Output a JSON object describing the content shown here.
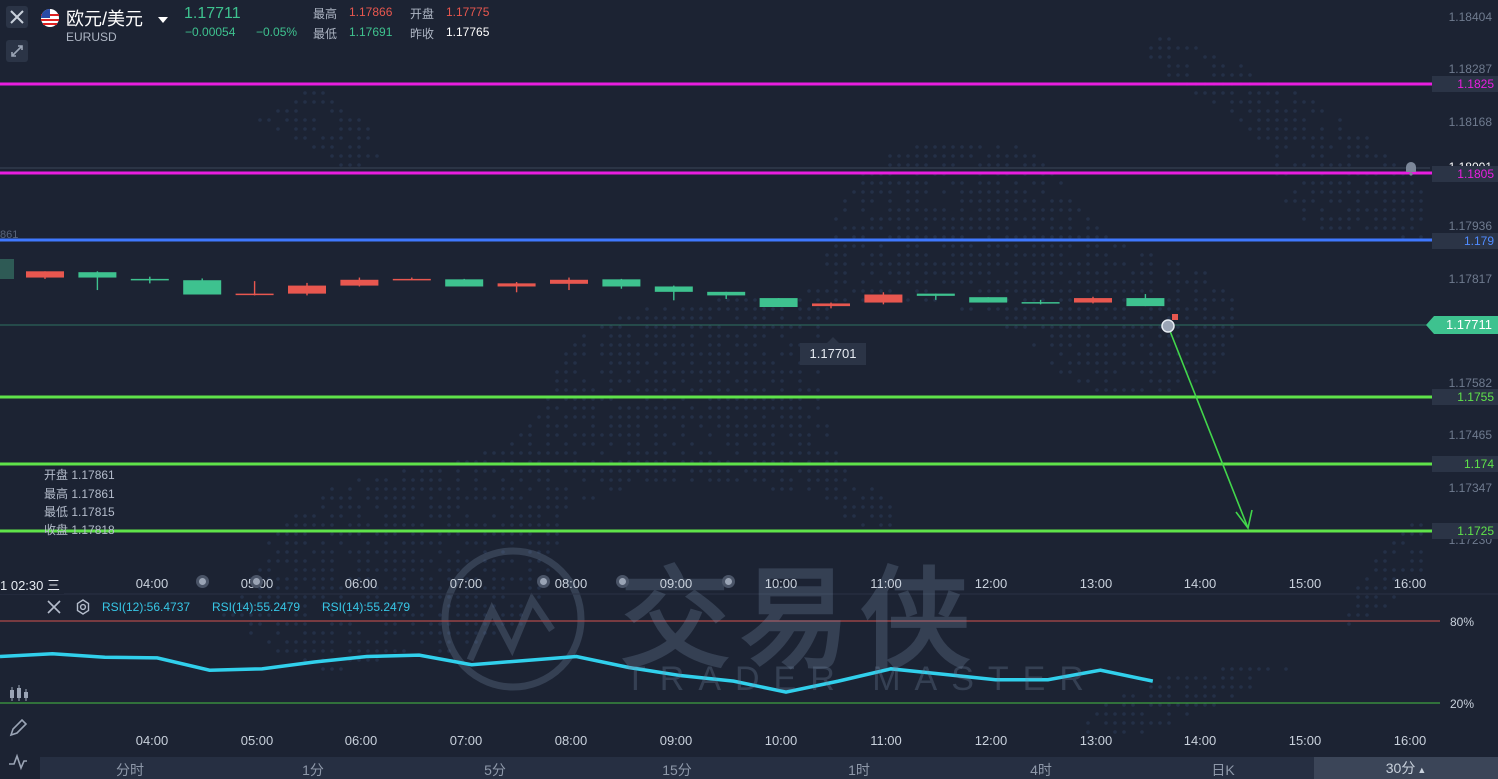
{
  "header": {
    "title": "欧元/美元",
    "symbol": "EURUSD",
    "price": "1.17711",
    "change": "−0.00054",
    "change_pct": "−0.05%",
    "high_label": "最高",
    "high_value": "1.17866",
    "open_label": "开盘",
    "open_value": "1.17775",
    "low_label": "最低",
    "low_value": "1.17691",
    "prev_close_label": "昨收",
    "prev_close_value": "1.17765"
  },
  "price_axis": [
    "1.18404",
    "1.18287",
    "1.18168",
    "1.17936",
    "1.17817",
    "1.17582",
    "1.17465",
    "1.17347",
    "1.17230"
  ],
  "price_axis_overlap": "1.18001",
  "lines": [
    {
      "label": "1.1825",
      "color": "#e91ee0"
    },
    {
      "label": "1.1805",
      "color": "#e91ee0"
    },
    {
      "label": "1.179",
      "color": "#3f78ff"
    },
    {
      "label": "1.1755",
      "color": "#5fe34a"
    },
    {
      "label": "1.174",
      "color": "#5fe34a"
    },
    {
      "label": "1.1725",
      "color": "#5fe34a"
    }
  ],
  "current_price_tag": "1.17711",
  "crosshair_value": "1.17701",
  "left_edge_value": "861",
  "ohlc": {
    "open": "开盘 1.17861",
    "high": "最高 1.17861",
    "low": "最低 1.17815",
    "close": "收盘 1.17818"
  },
  "time_cursor": "1 02:30 三",
  "time_axis": [
    "04:00",
    "05:00",
    "06:00",
    "07:00",
    "08:00",
    "09:00",
    "10:00",
    "11:00",
    "12:00",
    "13:00",
    "14:00",
    "15:00",
    "16:00"
  ],
  "rsi": {
    "rsi12": "RSI(12):56.4737",
    "rsi14a": "RSI(14):55.2479",
    "rsi14b": "RSI(14):55.2479",
    "level_high": "80%",
    "level_low": "20%"
  },
  "periods": [
    "分时",
    "1分",
    "5分",
    "15分",
    "1时",
    "4时",
    "日K",
    "30分"
  ],
  "active_period": "30分",
  "watermark": {
    "cn": "交易侠",
    "en": "TRADER MASTER"
  },
  "colors": {
    "up": "#3ec28f",
    "down": "#e8574f",
    "background": "#1c2333",
    "rsi": "#31d0ec"
  },
  "candles": [
    {
      "o": 1.17832,
      "h": 1.17832,
      "l": 1.17815,
      "c": 1.17818
    },
    {
      "o": 1.17818,
      "h": 1.17832,
      "l": 1.1779,
      "c": 1.1783
    },
    {
      "o": 1.17812,
      "h": 1.1782,
      "l": 1.17805,
      "c": 1.17815
    },
    {
      "o": 1.1778,
      "h": 1.17816,
      "l": 1.1778,
      "c": 1.17812
    },
    {
      "o": 1.17782,
      "h": 1.1781,
      "l": 1.17778,
      "c": 1.17781
    },
    {
      "o": 1.178,
      "h": 1.17806,
      "l": 1.17778,
      "c": 1.17782
    },
    {
      "o": 1.17813,
      "h": 1.17818,
      "l": 1.17798,
      "c": 1.178
    },
    {
      "o": 1.17815,
      "h": 1.17818,
      "l": 1.17813,
      "c": 1.17814
    },
    {
      "o": 1.17798,
      "h": 1.17815,
      "l": 1.17798,
      "c": 1.17814
    },
    {
      "o": 1.17805,
      "h": 1.17808,
      "l": 1.17785,
      "c": 1.17798
    },
    {
      "o": 1.17813,
      "h": 1.17818,
      "l": 1.1779,
      "c": 1.17804
    },
    {
      "o": 1.17798,
      "h": 1.17815,
      "l": 1.17793,
      "c": 1.17814
    },
    {
      "o": 1.17786,
      "h": 1.178,
      "l": 1.17767,
      "c": 1.17798
    },
    {
      "o": 1.17778,
      "h": 1.17786,
      "l": 1.1777,
      "c": 1.17786
    },
    {
      "o": 1.17752,
      "h": 1.17772,
      "l": 1.17752,
      "c": 1.17772
    },
    {
      "o": 1.1776,
      "h": 1.17762,
      "l": 1.17749,
      "c": 1.17754
    },
    {
      "o": 1.1778,
      "h": 1.17785,
      "l": 1.17758,
      "c": 1.17762
    },
    {
      "o": 1.17777,
      "h": 1.17782,
      "l": 1.17768,
      "c": 1.17782
    },
    {
      "o": 1.17762,
      "h": 1.17774,
      "l": 1.17762,
      "c": 1.17774
    },
    {
      "o": 1.17762,
      "h": 1.17768,
      "l": 1.17758,
      "c": 1.17763
    },
    {
      "o": 1.17772,
      "h": 1.17775,
      "l": 1.1776,
      "c": 1.17762
    },
    {
      "o": 1.17754,
      "h": 1.17781,
      "l": 1.17754,
      "c": 1.17772
    }
  ],
  "rsi_values": [
    54,
    56,
    53.5,
    53,
    44,
    45,
    50,
    54,
    55,
    48,
    51,
    54,
    46,
    40,
    36,
    28,
    36,
    45,
    41,
    37,
    37,
    44,
    36
  ]
}
